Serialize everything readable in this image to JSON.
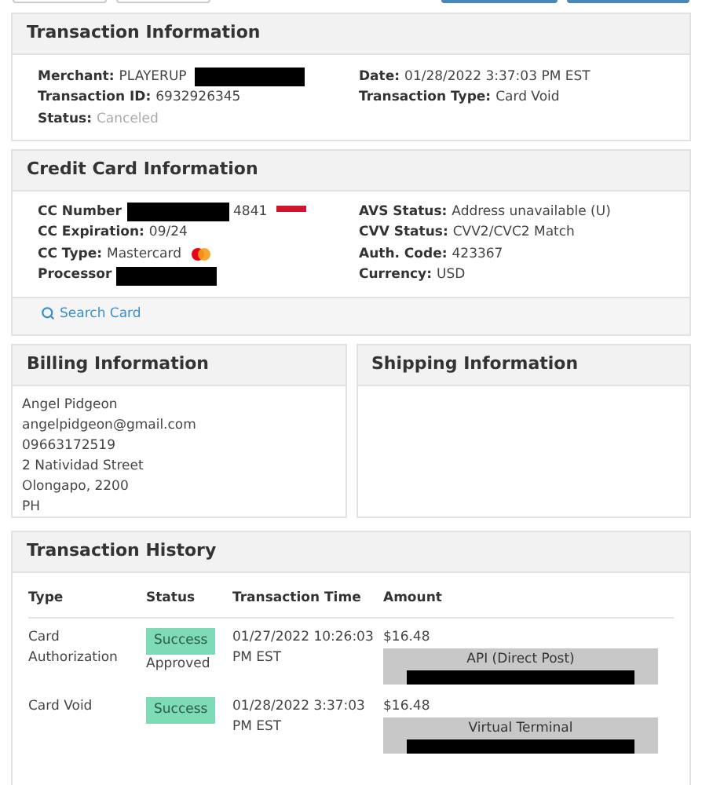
{
  "transaction_information": {
    "title": "Transaction Information",
    "left": [
      {
        "label": "Merchant:",
        "value": "PLAYERUP",
        "muted": false,
        "redacted": true
      },
      {
        "label": "Transaction ID:",
        "value": "6932926345",
        "muted": false
      },
      {
        "label": "Status:",
        "value": "Canceled",
        "muted": true
      }
    ],
    "right": [
      {
        "label": "Date:",
        "value": "01/28/2022 3:37:03 PM EST",
        "muted": false
      },
      {
        "label": "Transaction Type:",
        "value": "Card Void",
        "muted": false
      }
    ]
  },
  "credit_card_information": {
    "title": "Credit Card Information",
    "left": [
      {
        "kind": "card_number",
        "label": "CC Number",
        "value": "4841",
        "redacted": true
      },
      {
        "kind": "text",
        "label": "CC Expiration:",
        "value": "09/24"
      },
      {
        "kind": "card_type",
        "label": "CC Type:",
        "value": "Mastercard"
      },
      {
        "kind": "text",
        "label": "Processor",
        "redacted": true
      }
    ],
    "right": [
      {
        "label": "AVS Status:",
        "value": "Address unavailable (U)"
      },
      {
        "label": "CVV Status:",
        "value": "CVV2/CVC2 Match"
      },
      {
        "label": "Auth. Code:",
        "value": "423367"
      },
      {
        "label": "Currency:",
        "value": "USD"
      }
    ],
    "link": "Search Card"
  },
  "billing_information": {
    "title": "Billing Information",
    "lines": [
      "Angel Pidgeon",
      "angelpidgeon@gmail.com",
      "09663172519",
      "2 Natividad Street",
      "Olongapo, 2200",
      "PH"
    ]
  },
  "shipping_information": {
    "title": "Shipping Information"
  },
  "transaction_history": {
    "title": "Transaction History",
    "columns": [
      "Type",
      "Status",
      "Transaction Time",
      "Amount"
    ],
    "rows": [
      {
        "type": "Card Authorization",
        "status": "Success",
        "status_note": "Approved",
        "time": "01/27/2022 10:26:03 PM EST",
        "amount": "$16.48",
        "source": "API (Direct Post)"
      },
      {
        "type": "Card Void",
        "status": "Success",
        "time": "01/28/2022 3:37:03 PM EST",
        "amount": "$16.48",
        "source": "Virtual Terminal"
      }
    ]
  }
}
